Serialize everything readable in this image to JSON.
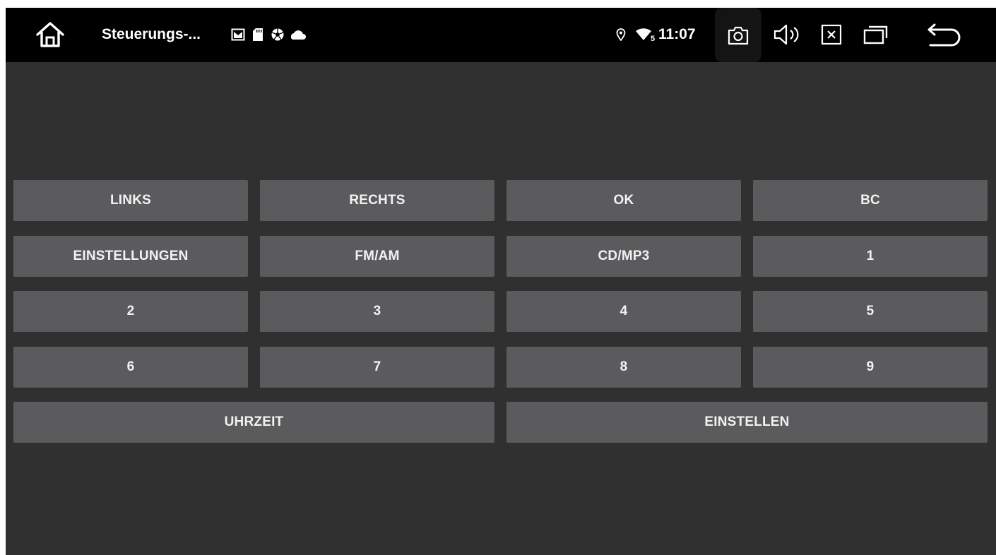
{
  "statusbar": {
    "title": "Steuerungs-...",
    "time": "11:07",
    "wifi_badge": "5",
    "icons": [
      "home-icon",
      "email-icon",
      "sd-card-icon",
      "soccer-ball-icon",
      "cloud-icon",
      "location-icon",
      "wifi-icon",
      "camera-icon",
      "volume-icon",
      "close-icon",
      "recents-icon",
      "back-icon"
    ]
  },
  "buttons": {
    "links": "LINKS",
    "rechts": "RECHTS",
    "ok": "OK",
    "bc": "BC",
    "einstellungen": "EINSTELLUNGEN",
    "fm_am": "FM/AM",
    "cd_mp3": "CD/MP3",
    "n1": "1",
    "n2": "2",
    "n3": "3",
    "n4": "4",
    "n5": "5",
    "n6": "6",
    "n7": "7",
    "n8": "8",
    "n9": "9",
    "uhrzeit": "UHRZEIT",
    "einstellen": "EINSTELLEN"
  },
  "colors": {
    "statusbar_bg": "#000000",
    "screen_bg": "#303030",
    "button_bg": "#5b5b5d",
    "text": "#ffffff"
  }
}
